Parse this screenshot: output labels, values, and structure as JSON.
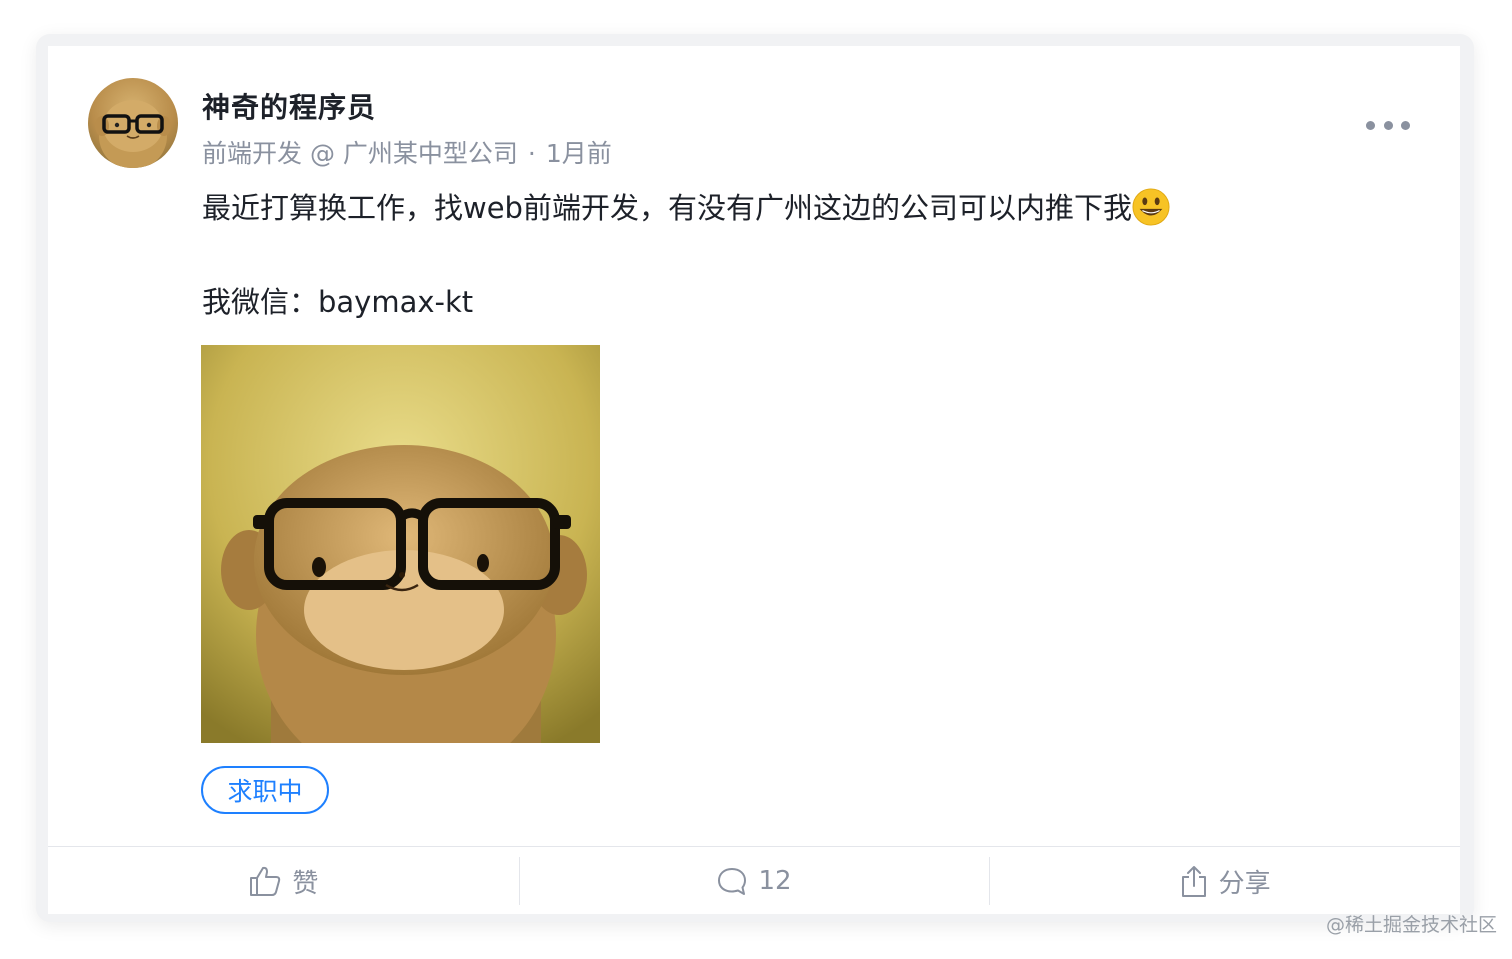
{
  "post": {
    "author_name": "神奇的程序员",
    "author_title": "前端开发 @ 广州某中型公司",
    "separator": "·",
    "time": "1月前",
    "line1": "最近打算换工作，找web前端开发，有没有广州这边的公司可以内推下我",
    "line2": "我微信：baymax-kt",
    "tag": "求职中"
  },
  "actions": {
    "like_label": "赞",
    "comment_count": "12",
    "share_label": "分享"
  },
  "watermark": "@稀土掘金技术社区",
  "colors": {
    "accent": "#1e80ff",
    "muted": "#8a919f",
    "text": "#1d2129"
  },
  "icons": {
    "more": "more-dots-icon",
    "like": "thumb-up-icon",
    "comment": "comment-bubble-icon",
    "share": "share-icon",
    "emoji": "smiley-emoji"
  }
}
